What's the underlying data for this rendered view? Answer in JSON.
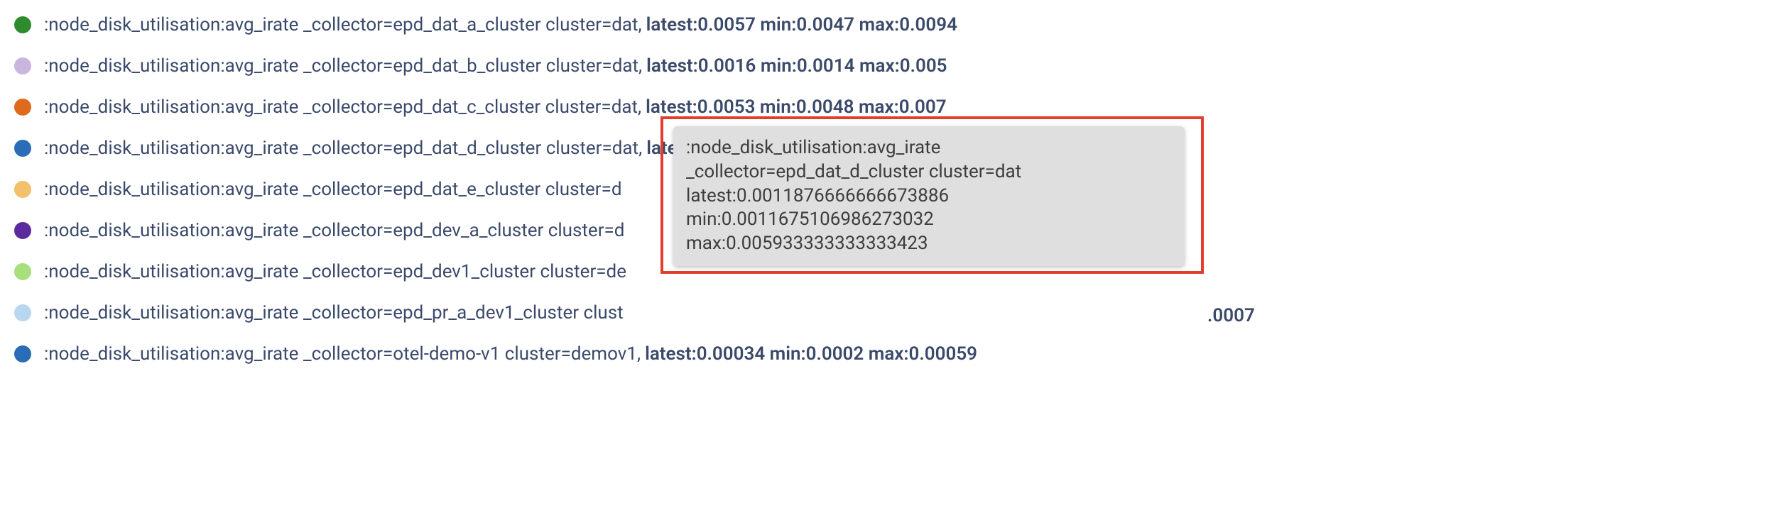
{
  "legend": {
    "items": [
      {
        "color": "#2e8b2e",
        "metric": ":node_disk_utilisation:avg_irate _collector=epd_dat_a_cluster cluster=dat,",
        "stats": "latest:0.0057 min:0.0047 max:0.0094"
      },
      {
        "color": "#c9b5de",
        "metric": ":node_disk_utilisation:avg_irate _collector=epd_dat_b_cluster cluster=dat,",
        "stats": "latest:0.0016 min:0.0014 max:0.005"
      },
      {
        "color": "#e06a1c",
        "metric": ":node_disk_utilisation:avg_irate _collector=epd_dat_c_cluster cluster=dat,",
        "stats": "latest:0.0053 min:0.0048 max:0.007"
      },
      {
        "color": "#2a6cb5",
        "metric": ":node_disk_utilisation:avg_irate _collector=epd_dat_d_cluster cluster=dat,",
        "stats": "latest:0.0012 min:0.0012 max:0.0059"
      },
      {
        "color": "#f3c16b",
        "metric": ":node_disk_utilisation:avg_irate _collector=epd_dat_e_cluster cluster=d",
        "stats": ""
      },
      {
        "color": "#5b2b9e",
        "metric": ":node_disk_utilisation:avg_irate _collector=epd_dev_a_cluster cluster=d",
        "stats": ""
      },
      {
        "color": "#a7e07a",
        "metric": ":node_disk_utilisation:avg_irate _collector=epd_dev1_cluster cluster=de",
        "stats": ""
      },
      {
        "color": "#b7d7ef",
        "metric": ":node_disk_utilisation:avg_irate _collector=epd_pr_a_dev1_cluster clust",
        "stats": ""
      },
      {
        "color": "#2a6cb5",
        "metric": ":node_disk_utilisation:avg_irate _collector=otel-demo-v1 cluster=demov1,",
        "stats": "latest:0.00034 min:0.0002 max:0.00059"
      }
    ]
  },
  "tooltip": {
    "line1": ":node_disk_utilisation:avg_irate",
    "line2": "_collector=epd_dat_d_cluster cluster=dat",
    "line3": "latest:0.0011876666666673886",
    "line4": "min:0.0011675106986273032",
    "line5": "max:0.005933333333333423"
  },
  "trail_stat": ".0007"
}
